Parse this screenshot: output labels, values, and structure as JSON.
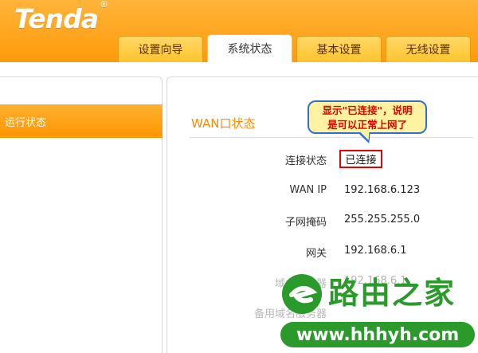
{
  "header": {
    "logo": "Tenda",
    "tabs": [
      "设置向导",
      "系统状态",
      "基本设置",
      "无线设置"
    ],
    "active_tab": "系统状态"
  },
  "sidebar": {
    "items": [
      {
        "label": "运行状态",
        "active": true
      }
    ]
  },
  "main": {
    "section_title": "WAN口状态",
    "rows": [
      {
        "label": "连接状态",
        "value": "已连接"
      },
      {
        "label": "WAN IP",
        "value": "192.168.6.123"
      },
      {
        "label": "子网掩码",
        "value": "255.255.255.0"
      },
      {
        "label": "网关",
        "value": "192.168.6.1"
      },
      {
        "label": "域名服务器",
        "value": "192.168.6.1"
      },
      {
        "label": "备用域名服务器",
        "value": ""
      }
    ]
  },
  "annotation": {
    "line1": "显示\"已连接\"，说明",
    "line2": "是可以正常上网了"
  },
  "watermark": {
    "text": "路由之家",
    "url": "www.hhhyh.com"
  },
  "colors": {
    "header": "#ff9a0a",
    "tab": "#ffc42e",
    "accent": "#ff8a00",
    "highlight_box": "#e60000",
    "watermark": "#2a9a2a"
  }
}
